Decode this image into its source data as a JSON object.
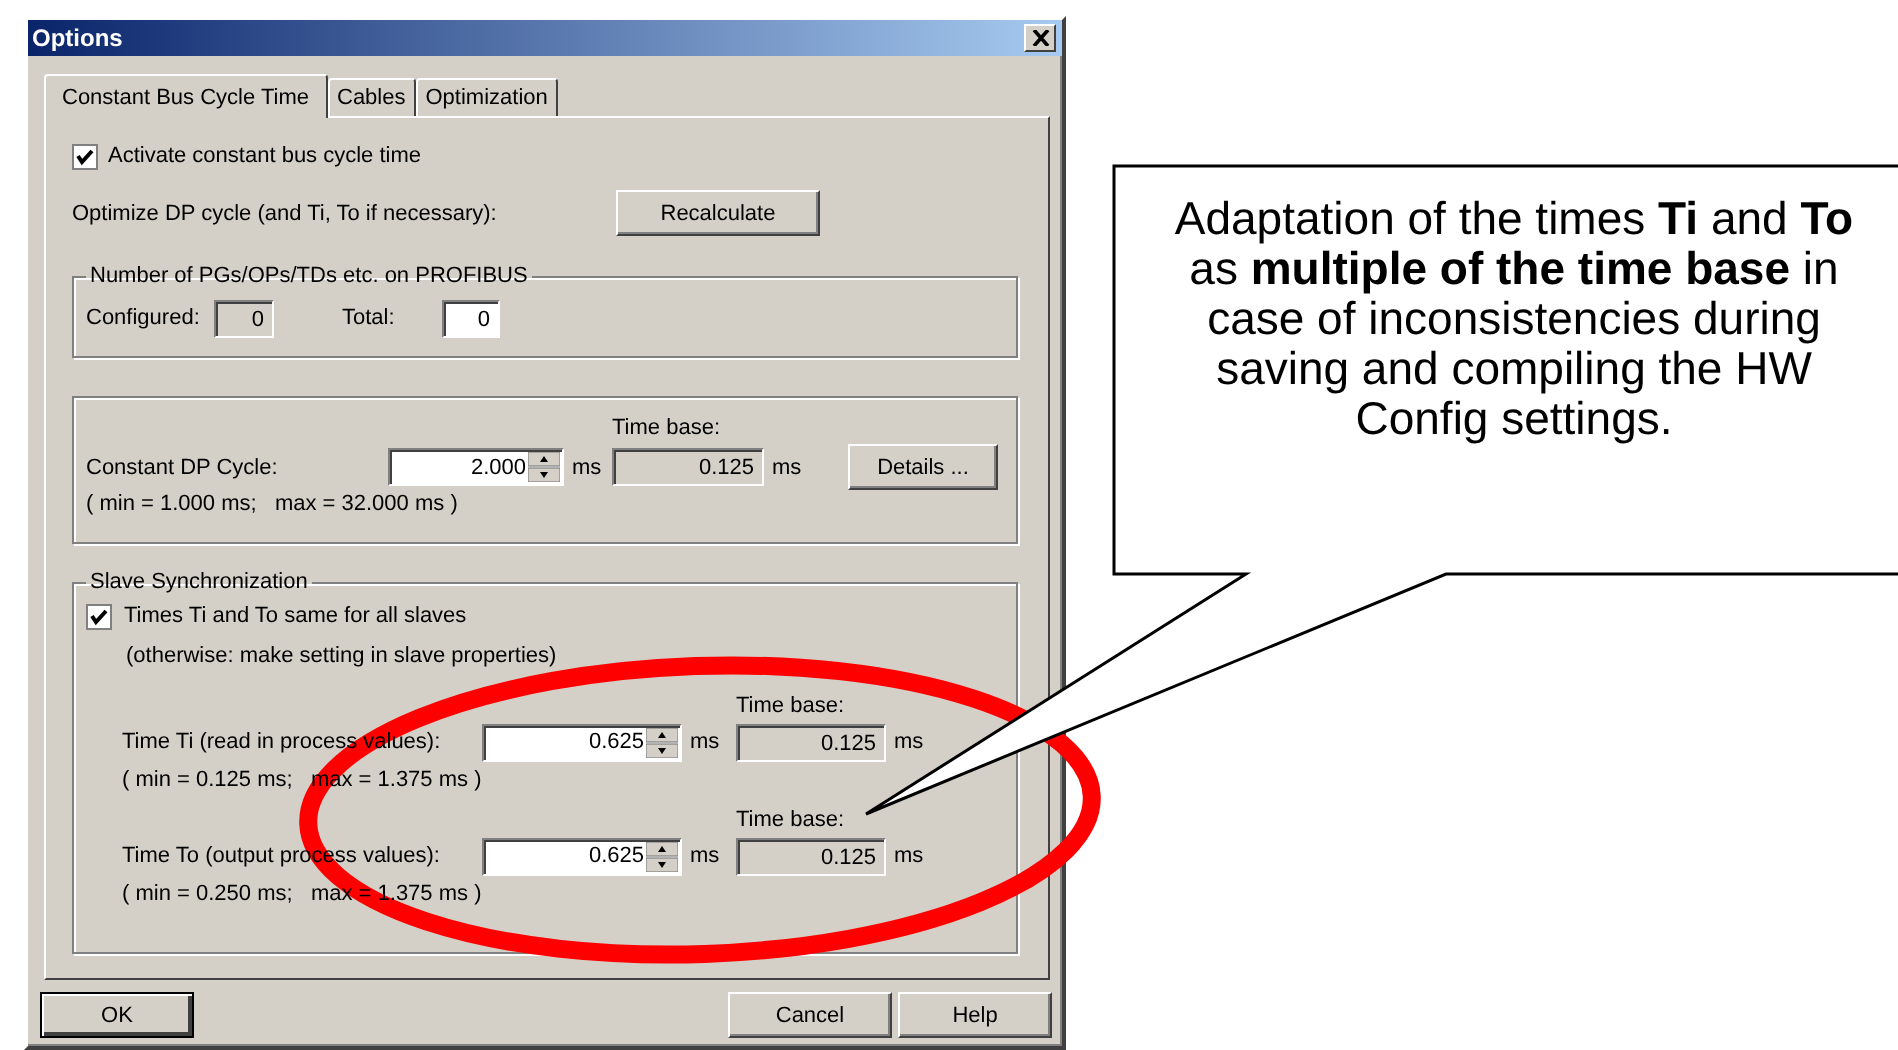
{
  "window": {
    "title": "Options"
  },
  "tabs": [
    {
      "label": "Constant Bus Cycle Time",
      "selected": true
    },
    {
      "label": "Cables",
      "selected": false
    },
    {
      "label": "Optimization",
      "selected": false
    }
  ],
  "activate": {
    "label": "Activate constant bus cycle time",
    "checked": true
  },
  "optimize": {
    "label": "Optimize DP cycle (and Ti, To if necessary):",
    "button": "Recalculate"
  },
  "pg_group": {
    "title": "Number of PGs/OPs/TDs etc. on PROFIBUS",
    "configured_label": "Configured:",
    "configured_value": "0",
    "total_label": "Total:",
    "total_value": "0"
  },
  "dp_cycle": {
    "label": "Constant DP Cycle:",
    "value": "2.000",
    "unit": "ms",
    "time_base_label": "Time base:",
    "time_base_value": "0.125",
    "time_base_unit": "ms",
    "range": "( min = 1.000 ms;   max = 32.000 ms )",
    "button": "Details ..."
  },
  "slave_sync": {
    "title": "Slave Synchronization",
    "checkbox": {
      "label": "Times Ti and To same for all slaves",
      "checked": true
    },
    "note": "(otherwise: make setting in slave properties)",
    "rows": [
      {
        "label": "Time Ti (read in process values):",
        "value": "0.625",
        "unit": "ms",
        "time_base_label": "Time base:",
        "time_base_value": "0.125",
        "time_base_unit": "ms",
        "range": "( min = 0.125 ms;   max = 1.375 ms )"
      },
      {
        "label": "Time To (output process values):",
        "value": "0.625",
        "unit": "ms",
        "time_base_label": "Time base:",
        "time_base_value": "0.125",
        "time_base_unit": "ms",
        "range": "( min = 0.250 ms;   max = 1.375 ms )"
      }
    ]
  },
  "buttons": [
    {
      "label": "OK",
      "default": true
    },
    {
      "label": "Cancel",
      "default": false
    },
    {
      "label": "Help",
      "default": false
    }
  ],
  "callout": {
    "text": "Adaptation of the times **Ti** and **To** as **multiple of the time base** in case of inconsistencies during saving and compiling the HW Config settings."
  }
}
